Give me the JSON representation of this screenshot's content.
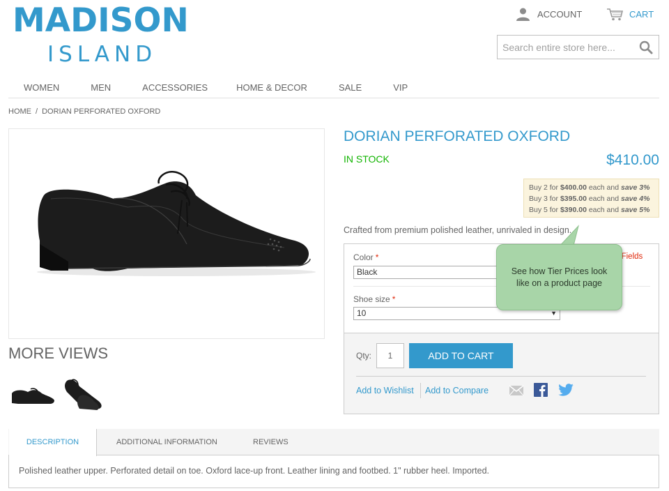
{
  "logo": {
    "main": "MADISON",
    "sub": "ISLAND"
  },
  "header": {
    "account_label": "ACCOUNT",
    "cart_label": "CART"
  },
  "search": {
    "placeholder": "Search entire store here..."
  },
  "nav": [
    "WOMEN",
    "MEN",
    "ACCESSORIES",
    "HOME & DECOR",
    "SALE",
    "VIP"
  ],
  "breadcrumb": {
    "home": "HOME",
    "separator": "/",
    "current": "DORIAN PERFORATED OXFORD"
  },
  "gallery": {
    "more_views_label": "MORE VIEWS"
  },
  "product": {
    "name": "DORIAN PERFORATED OXFORD",
    "availability": "IN STOCK",
    "price": "$410.00",
    "short_description": "Crafted from premium polished leather, unrivaled in design.",
    "tier_prices": [
      {
        "prefix": "Buy 2 for",
        "price": "$400.00",
        "mid": "each and",
        "save": "save 3%"
      },
      {
        "prefix": "Buy 3 for",
        "price": "$395.00",
        "mid": "each and",
        "save": "save 4%"
      },
      {
        "prefix": "Buy 5 for",
        "price": "$390.00",
        "mid": "each and",
        "save": "save 5%"
      }
    ]
  },
  "options": {
    "required_note": "d Fields",
    "color": {
      "label": "Color",
      "required_mark": "*",
      "value": "Black"
    },
    "shoe_size": {
      "label": "Shoe size",
      "required_mark": "*",
      "value": "10"
    }
  },
  "cart_box": {
    "qty_label": "Qty:",
    "qty_value": "1",
    "add_to_cart": "ADD TO CART",
    "wishlist": "Add to Wishlist",
    "compare": "Add to Compare"
  },
  "tooltip": {
    "text": "See how Tier Prices look like on a product page"
  },
  "tabs": {
    "items": [
      "DESCRIPTION",
      "ADDITIONAL INFORMATION",
      "REVIEWS"
    ],
    "active": "DESCRIPTION",
    "content": "Polished leather upper. Perforated detail on toe. Oxford lace-up front. Leather lining and footbed. 1\" rubber heel. Imported."
  },
  "colors": {
    "accent": "#3399cc",
    "in_stock": "#11b400",
    "required": "#df280a",
    "tooltip_bg": "#a8d5a8",
    "tier_bg": "#fbf4de"
  },
  "icons": [
    "account-icon",
    "cart-icon",
    "search-icon",
    "email-icon",
    "facebook-icon",
    "twitter-icon",
    "dropdown-arrow-icon"
  ]
}
